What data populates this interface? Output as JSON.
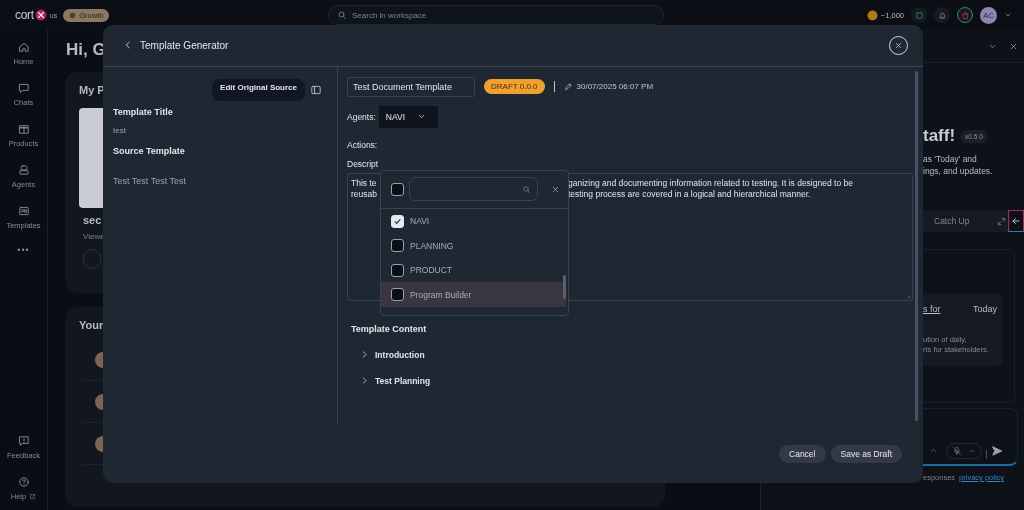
{
  "top_bar": {
    "logo_text": "cort",
    "region": "us",
    "plan_badge": "Growth",
    "search": {
      "placeholder": "Search in workspace"
    },
    "credits": "~1,000",
    "avatar": "AC"
  },
  "nav": {
    "items": [
      {
        "label": "Home"
      },
      {
        "label": "Chats"
      },
      {
        "label": "Products"
      },
      {
        "label": "Agents"
      },
      {
        "label": "Templates"
      }
    ],
    "more": "•••",
    "footer": [
      {
        "label": "Feedback"
      },
      {
        "label": "Help"
      }
    ]
  },
  "home": {
    "greeting": "Hi, G",
    "recent_card": {
      "title": "My P",
      "item_title": "sec",
      "item_meta": "Viewe"
    },
    "list_card": {
      "title": "Your"
    }
  },
  "assistant": {
    "heading": "taff!",
    "version": "v0.5.0",
    "intro_lines": [
      "as 'Today' and",
      "ings, and updates."
    ],
    "tab": "Catch Up",
    "card": {
      "title": "s for",
      "date": "Today",
      "lines": [
        "ution of daily,",
        "rts for stakeholders."
      ]
    },
    "disclaimer": "esponses",
    "privacy_link": "privacy policy"
  },
  "modal": {
    "title": "Template Generator",
    "edit_source_button": "Edit Original Source",
    "sidebar": [
      {
        "label": "Template Title",
        "value": "test"
      },
      {
        "label": "Source Template",
        "value": "Test Test Test Test"
      }
    ],
    "document_name": "Test Document Template",
    "status_badge": "DRAFT 0.0.0",
    "updated": "30/07/2025 06:07 PM",
    "agents": {
      "label": "Agents:",
      "value": "NAVI"
    },
    "actions_label": "Actions:",
    "description_label": "Descript",
    "description_lines": [
      {
        "start": "This te",
        "end": "ganizing and documenting information related to testing. It is designed to be"
      },
      {
        "start": "reusab",
        "end": "testing process are covered in a logical and hierarchical manner."
      }
    ],
    "content_heading": "Template Content",
    "sections": [
      {
        "title": "Introduction",
        "expanded": false
      },
      {
        "title": "Test Planning",
        "expanded": false
      }
    ],
    "buttons": [
      "Cancel",
      "Save as Draft"
    ]
  },
  "agent_dropdown": {
    "select_all": {
      "checked": false
    },
    "options": [
      {
        "label": "NAVI",
        "checked": true,
        "highlighted": false
      },
      {
        "label": "PLANNING",
        "checked": false,
        "highlighted": false
      },
      {
        "label": "PRODUCT",
        "checked": false,
        "highlighted": false
      },
      {
        "label": "Program Builder",
        "checked": false,
        "highlighted": true
      }
    ]
  }
}
